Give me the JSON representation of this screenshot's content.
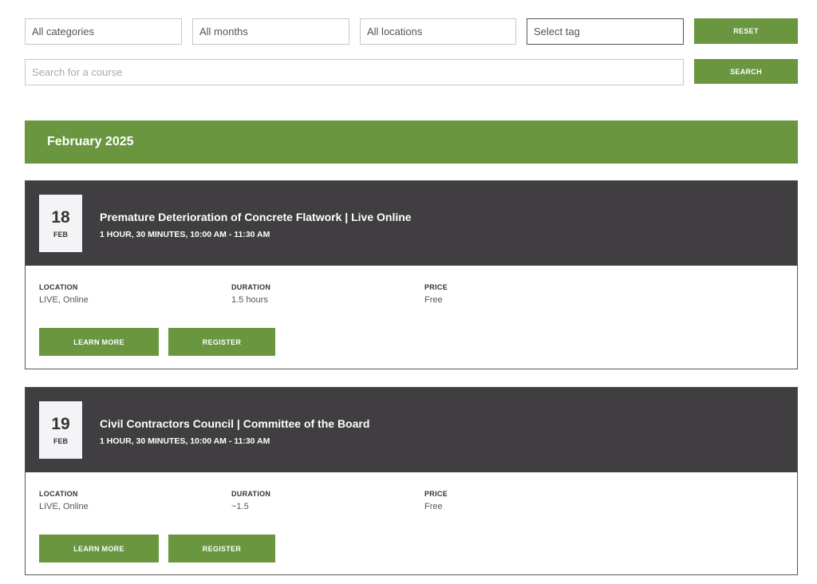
{
  "filters": {
    "categories": "All categories",
    "months": "All months",
    "locations": "All locations",
    "tag": "Select tag",
    "reset_label": "RESET"
  },
  "search": {
    "placeholder": "Search for a course",
    "button_label": "SEARCH"
  },
  "month_heading": "February 2025",
  "events": [
    {
      "day": "18",
      "month": "FEB",
      "title": "Premature Deterioration of Concrete Flatwork | Live Online",
      "time": "1 HOUR, 30 MINUTES, 10:00 AM - 11:30 AM",
      "location_label": "LOCATION",
      "location": "LIVE, Online",
      "duration_label": "DURATION",
      "duration": "1.5 hours",
      "price_label": "PRICE",
      "price": "Free",
      "learn_more_label": "LEARN MORE",
      "register_label": "REGISTER"
    },
    {
      "day": "19",
      "month": "FEB",
      "title": "Civil Contractors Council | Committee of the Board",
      "time": "1 HOUR, 30 MINUTES, 10:00 AM - 11:30 AM",
      "location_label": "LOCATION",
      "location": "LIVE, Online",
      "duration_label": "DURATION",
      "duration": "~1.5",
      "price_label": "PRICE",
      "price": "Free",
      "learn_more_label": "LEARN MORE",
      "register_label": "REGISTER"
    }
  ],
  "colors": {
    "accent_green": "#6a9640",
    "header_dark": "#403e40"
  }
}
